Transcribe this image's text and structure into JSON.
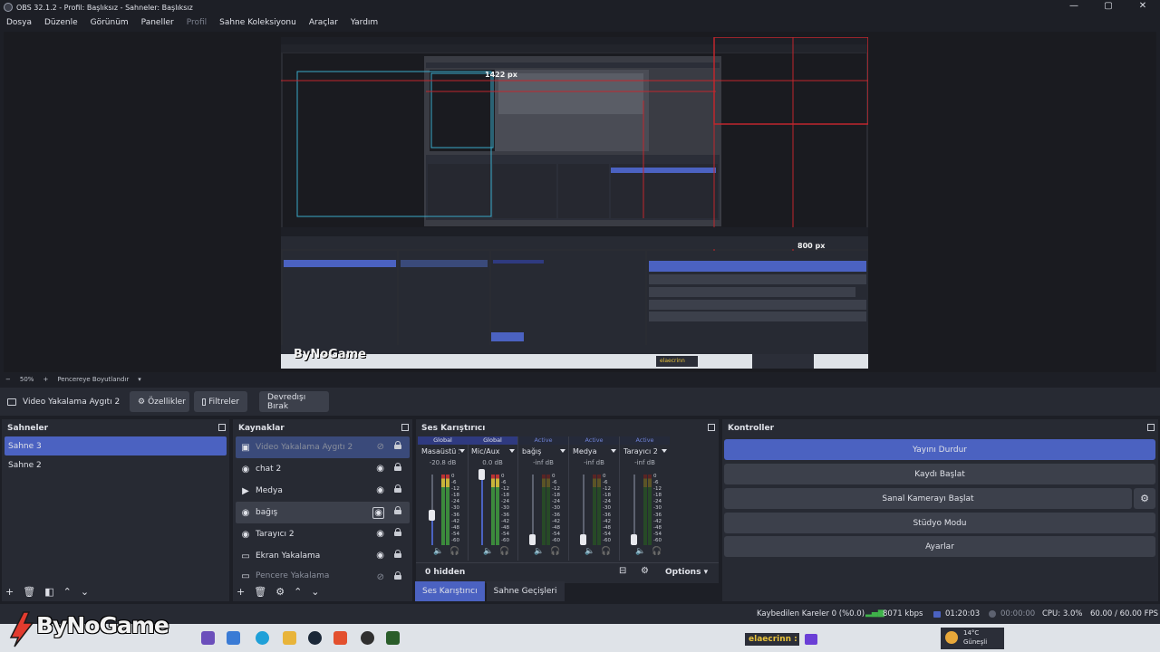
{
  "window": {
    "title": "OBS 32.1.2 - Profil: Başlıksız - Sahneler: Başlıksız",
    "min": "—",
    "max": "▢",
    "close": "✕"
  },
  "menu": [
    "Dosya",
    "Düzenle",
    "Görünüm",
    "Paneller",
    "Profil",
    "Sahne Koleksiyonu",
    "Araçlar",
    "Yardım"
  ],
  "preview": {
    "zoom_minus": "−",
    "zoom_value": "50%",
    "zoom_plus": "+",
    "fit_label": "Pencereye Boyutlandır",
    "measure_width": "1422 px",
    "measure_height": "800 px",
    "inner_brand": "ByNoGame",
    "inner_user": "elaecrinn"
  },
  "source_toolbar": {
    "source_name": "Video Yakalama Aygıtı 2",
    "properties": "Özellikler",
    "filters": "Filtreler",
    "deactivate": "Devredışı Bırak"
  },
  "scenes": {
    "title": "Sahneler",
    "items": [
      "Sahne 3",
      "Sahne 2"
    ],
    "selected_index": 0
  },
  "sources": {
    "title": "Kaynaklar",
    "items": [
      {
        "label": "Video Yakalama Aygıtı 2",
        "icon": "camera-icon",
        "visible": false
      },
      {
        "label": "chat 2",
        "icon": "globe-icon",
        "visible": true
      },
      {
        "label": "Medya",
        "icon": "play-icon",
        "visible": true
      },
      {
        "label": "bağış",
        "icon": "globe-icon",
        "visible": true
      },
      {
        "label": "Tarayıcı 2",
        "icon": "globe-icon",
        "visible": true
      },
      {
        "label": "Ekran Yakalama",
        "icon": "monitor-icon",
        "visible": true
      },
      {
        "label": "Pencere Yakalama",
        "icon": "window-icon",
        "visible": false
      }
    ]
  },
  "mixer": {
    "title": "Ses Karıştırıcı",
    "channels": [
      {
        "head": "Global",
        "name": "Masaüstü Ses",
        "db": "-20.8 dB",
        "level": 0.42
      },
      {
        "head": "Global",
        "name": "Mic/Aux",
        "db": "0.0 dB",
        "level": 1.0
      },
      {
        "head": "Active",
        "name": "bağış",
        "db": "-inf dB",
        "level": 0.0
      },
      {
        "head": "Active",
        "name": "Medya",
        "db": "-inf dB",
        "level": 0.0
      },
      {
        "head": "Active",
        "name": "Tarayıcı 2",
        "db": "-inf dB",
        "level": 0.0
      }
    ],
    "scale": [
      "0",
      "-6",
      "-12",
      "-18",
      "-24",
      "-30",
      "-36",
      "-42",
      "-48",
      "-54",
      "-60"
    ],
    "hidden": "0 hidden",
    "options": "Options"
  },
  "controls": {
    "title": "Kontroller",
    "stop_stream": "Yayını Durdur",
    "start_record": "Kaydı Başlat",
    "start_virtualcam": "Sanal Kamerayı Başlat",
    "studio_mode": "Stüdyo Modu",
    "settings": "Ayarlar"
  },
  "tabs": [
    "Ses Karıştırıcı",
    "Sahne Geçişleri"
  ],
  "status": {
    "dropped": "Kaybedilen Kareler 0 (%0.0)",
    "bitrate": "8071 kbps",
    "stream_time": "01:20:03",
    "record_time": "00:00:00",
    "cpu": "CPU: 3.0%",
    "fps": "60.00 / 60.00 FPS"
  },
  "overlay": {
    "brand": "ByNoGame",
    "user": "elaecrinn :",
    "weather_temp": "14°C",
    "weather_desc": "Güneşli"
  },
  "colors": {
    "accent": "#4b62c1",
    "bg": "#1d1f26",
    "panel": "#272a33"
  }
}
